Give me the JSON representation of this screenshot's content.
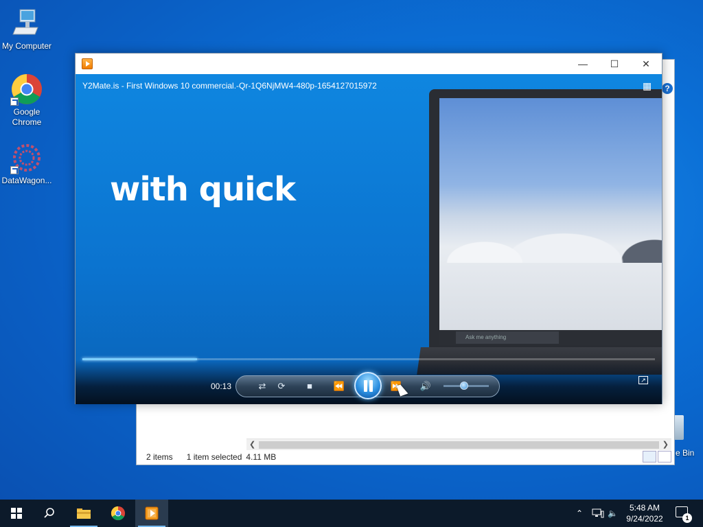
{
  "desktop": {
    "icons": [
      {
        "label": "My Computer"
      },
      {
        "label": "Google Chrome"
      },
      {
        "label": "DataWagon..."
      }
    ],
    "recycle_bin_label": "e Bin"
  },
  "explorer": {
    "status_items": "2 items",
    "status_selected": "1 item selected",
    "status_size": "4.11 MB",
    "help_symbol": "?"
  },
  "player": {
    "window_buttons": {
      "minimize": "—",
      "maximize": "☐",
      "close": "✕"
    },
    "video_title": "Y2Mate.is - First Windows 10 commercial.-Qr-1Q6NjMW4-480p-1654127015972",
    "caption": "with quick",
    "search_hint": "Ask me anything",
    "current_time": "00:13",
    "progress": 0.2,
    "volume": 0.45,
    "state": "playing",
    "accent": "#2c8fe0"
  },
  "taskbar": {
    "time": "5:48 AM",
    "date": "9/24/2022",
    "notification_count": "1",
    "pinned": [
      {
        "icon": "search-icon"
      },
      {
        "icon": "file-explorer-icon"
      },
      {
        "icon": "chrome-icon"
      },
      {
        "icon": "media-player-icon"
      }
    ]
  }
}
